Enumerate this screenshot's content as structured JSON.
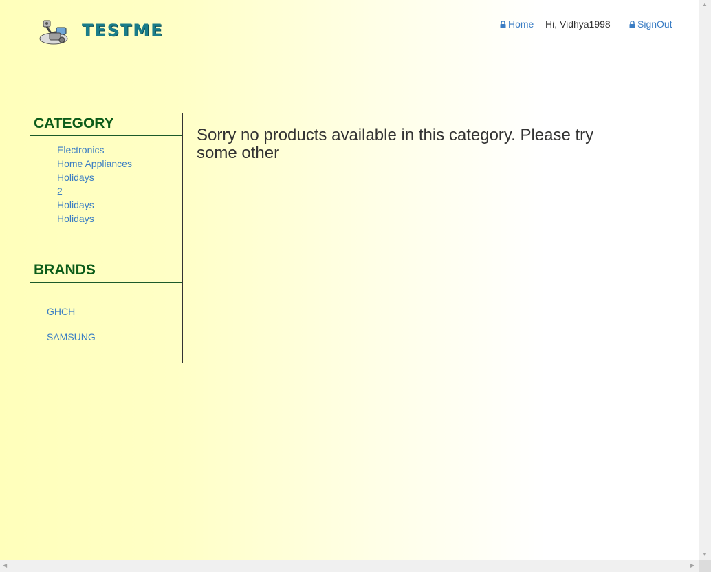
{
  "header": {
    "logo_text": "TESTME",
    "nav": {
      "home_label": "Home",
      "greeting": "Hi, Vidhya1998",
      "signout_label": "SignOut"
    }
  },
  "sidebar": {
    "category_title": "CATEGORY",
    "categories": [
      {
        "label": "Electronics"
      },
      {
        "label": "Home Appliances"
      },
      {
        "label": "Holidays"
      },
      {
        "label": "2"
      },
      {
        "label": "Holidays"
      },
      {
        "label": "Holidays"
      }
    ],
    "brands_title": "BRANDS",
    "brands": [
      {
        "label": "GHCH"
      },
      {
        "label": "SAMSUNG"
      }
    ]
  },
  "main": {
    "message": "Sorry no products available in this category. Please try some other"
  },
  "colors": {
    "link": "#3a7dc4",
    "heading": "#0c5c1a",
    "logo": "#1a7d8a",
    "background_start": "#ffffbb"
  }
}
